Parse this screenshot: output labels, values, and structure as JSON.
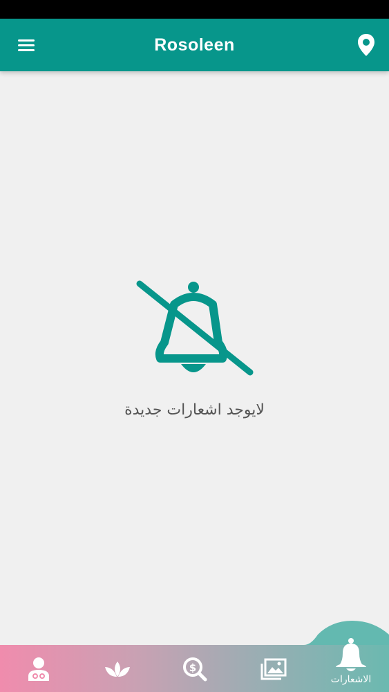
{
  "app": {
    "title": "Rosoleen",
    "accent_color": "#07968b"
  },
  "header": {
    "menu_icon": "hamburger-menu-icon",
    "location_icon": "map-pin-icon"
  },
  "empty_state": {
    "icon": "bell-off-icon",
    "message": "لايوجد اشعارات جديدة"
  },
  "bottom_nav": {
    "items": [
      {
        "icon": "doctor-icon",
        "label": ""
      },
      {
        "icon": "lotus-icon",
        "label": ""
      },
      {
        "icon": "dollar-search-icon",
        "label": ""
      },
      {
        "icon": "gallery-icon",
        "label": ""
      },
      {
        "icon": "bell-icon",
        "label": "الاشعارات",
        "active": true
      }
    ]
  }
}
